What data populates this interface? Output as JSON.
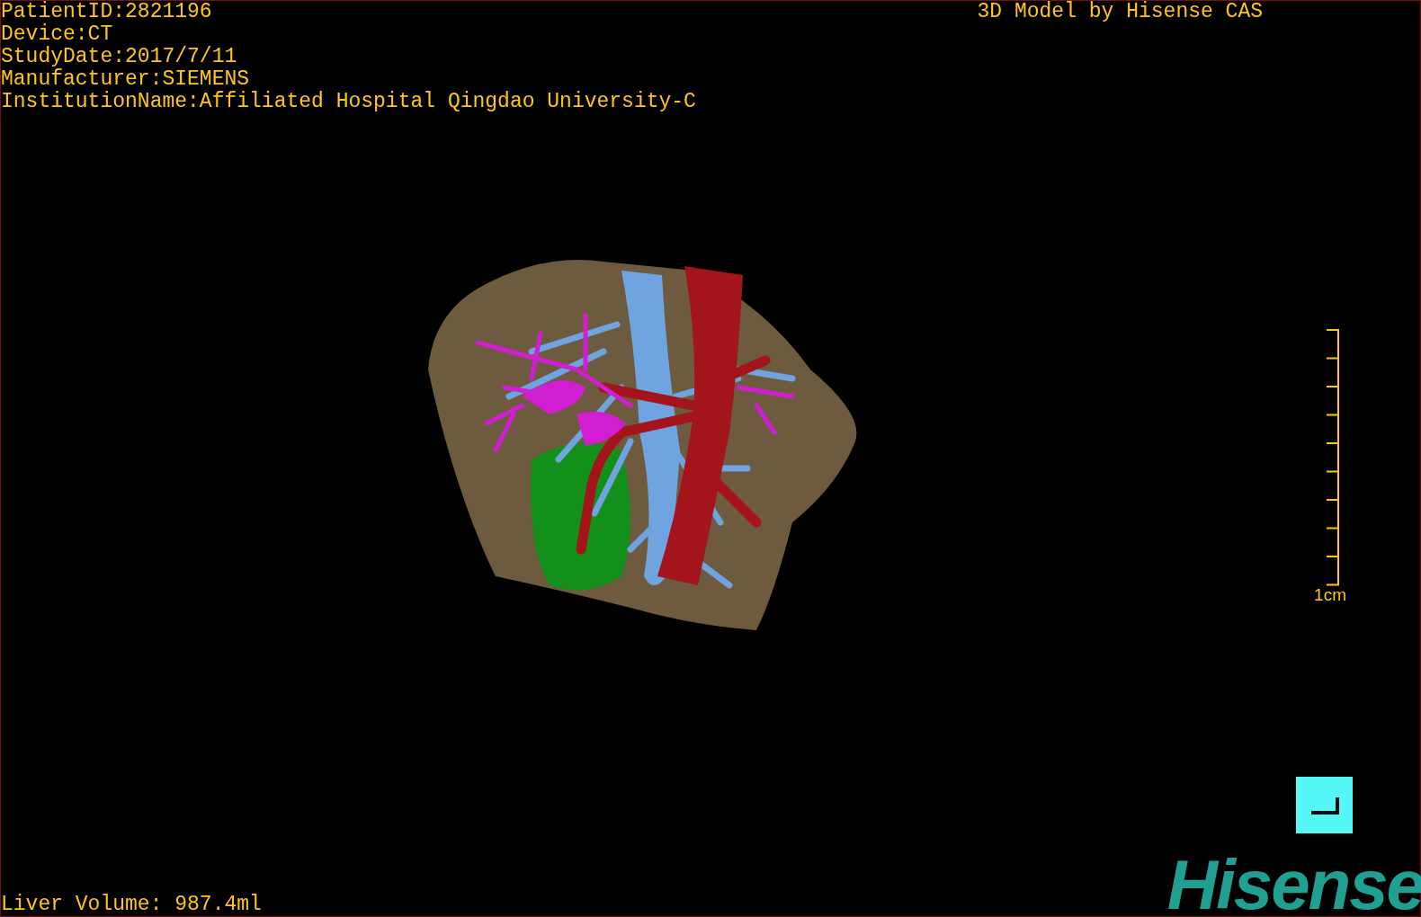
{
  "header": {
    "info_lines": [
      "PatientID:2821196",
      "Device:CT",
      "StudyDate:2017/7/11",
      "Manufacturer:SIEMENS",
      "InstitutionName:Affiliated Hospital Qingdao University-C"
    ],
    "title": "3D Model by Hisense CAS"
  },
  "scale_bar": {
    "label": "1cm"
  },
  "footer": {
    "volume": "Liver Volume: 987.4ml",
    "logo": "Hisense"
  }
}
